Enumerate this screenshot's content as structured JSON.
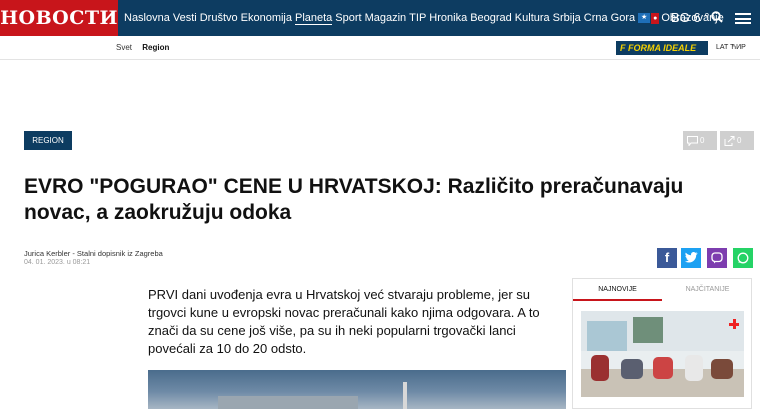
{
  "header": {
    "logo": "НОВОСТИ",
    "nav": [
      "Naslovna",
      "Vesti",
      "Društvo",
      "Ekonomija",
      "Planeta",
      "Sport",
      "Magazin",
      "TIP",
      "Hronika",
      "Beograd",
      "Kultura",
      "Srbija",
      "Crna Gora"
    ],
    "nav_active": "Planeta",
    "nav_extra": "Obrazovanje",
    "weather": "BG 6 °",
    "accent": "#c8151b",
    "bar_color": "#0d3c61"
  },
  "subnav": {
    "links": [
      "Svet",
      "Region"
    ],
    "active": "Region",
    "ad_label": "FORMA IDEALE",
    "lang": "LAT ЋИР"
  },
  "article": {
    "category": "REGION",
    "comments": "0",
    "shares": "0",
    "title": "EVRO \"POGURAO\" CENE U HRVATSKOJ: Različito preračunavaju novac, a zaokružuju odoka",
    "author": "Jurica Kerbler - Stalni dopisnik iz Zagreba",
    "date": "04. 01. 2023. u 08:21",
    "lead": "PRVI dani uvođenja evra u Hrvatskoj već stvaraju probleme, jer su trgovci kune u evropski novac preračunali kako njima odgovara. A to znači da su cene još više, pa su ih neki popularni trgovački lanci povećali za 10 do 20 odsto."
  },
  "share": {
    "facebook": "f",
    "twitter": "t",
    "viber": "v",
    "whatsapp": "w"
  },
  "sidebar": {
    "tabs": [
      "NAJNOVIJE",
      "NAJČITANIJE"
    ]
  }
}
